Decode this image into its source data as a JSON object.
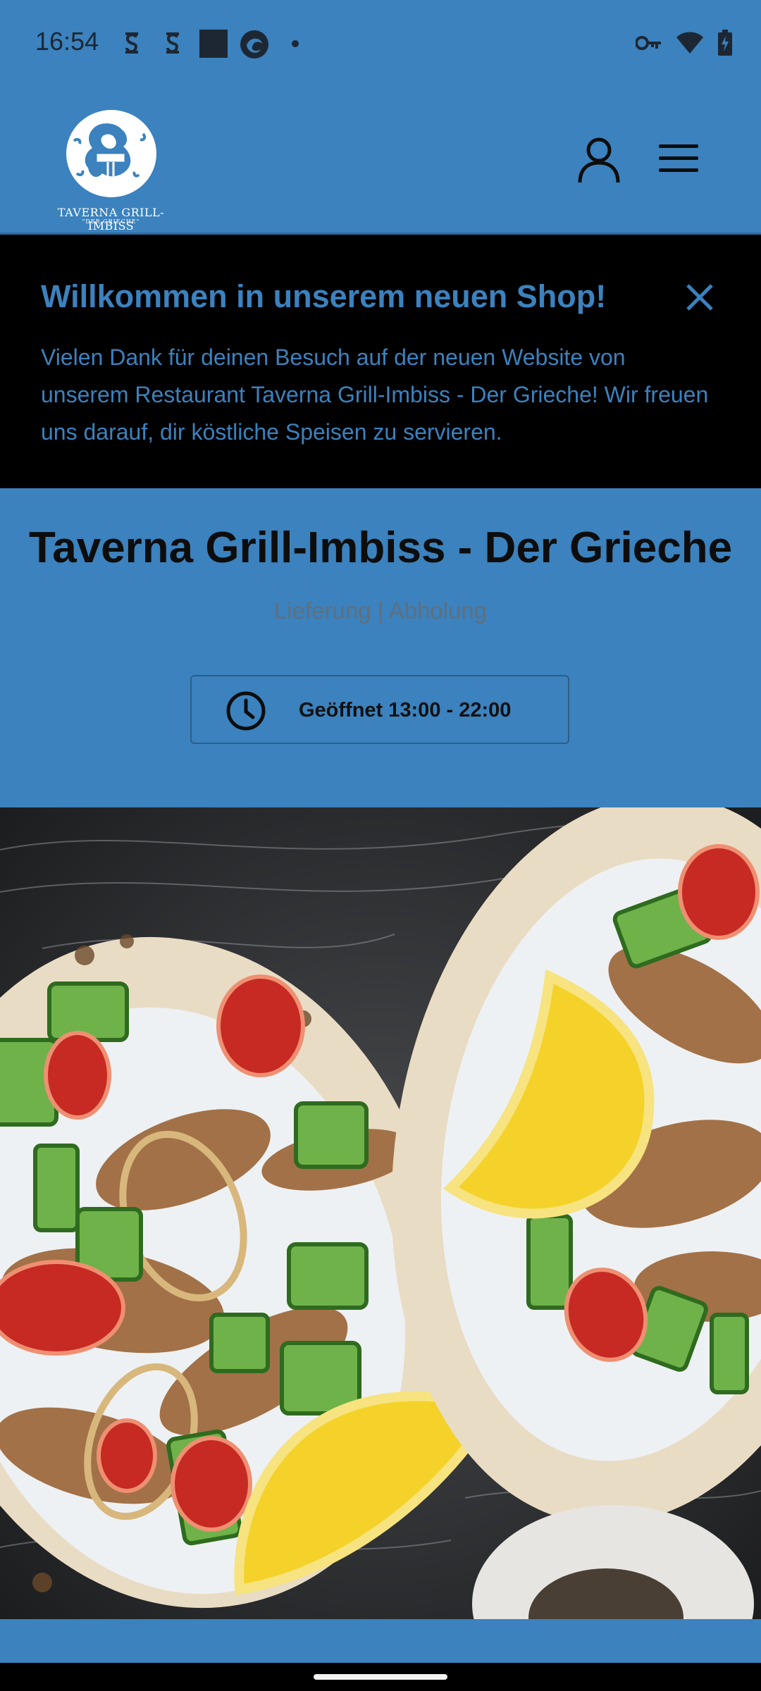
{
  "status_bar": {
    "time": "16:54",
    "icons_left": [
      "notification-s-icon",
      "notification-s-icon",
      "app-square-icon",
      "app-circle-icon",
      "dot-icon"
    ],
    "icons_right": [
      "key-icon",
      "wifi-icon",
      "battery-charging-icon"
    ]
  },
  "header": {
    "logo_text": "TAVERNA GRILL-IMBISS",
    "logo_subtext": "\"DER GRIECHE\"",
    "user_icon": "user-icon",
    "menu_icon": "hamburger-menu-icon"
  },
  "banner": {
    "title": "Willkommen in unserem neuen Shop!",
    "text": "Vielen Dank für deinen Besuch auf der neuen Website von unserem Restaurant Taverna Grill-Imbiss - Der Grieche! Wir freuen uns darauf, dir köstliche Speisen zu servieren."
  },
  "restaurant": {
    "name": "Taverna Grill-Imbiss - Der Grieche",
    "service_modes": "Lieferung | Abholung",
    "hours_label": "Geöffnet 13:00 - 22:00"
  },
  "hero": {
    "image_description_icon": "gyros-pita-photo"
  },
  "colors": {
    "brand_blue": "#3b82be",
    "banner_bg": "#000000",
    "text_dark": "#0d0d0d",
    "subtitle_gray": "#5f6f7e"
  }
}
